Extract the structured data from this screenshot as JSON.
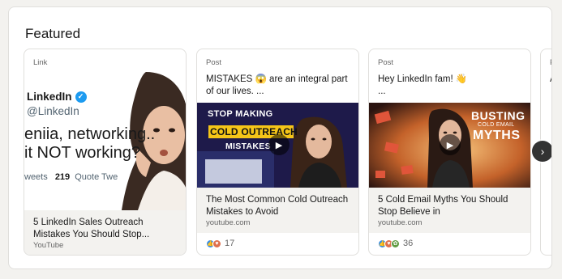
{
  "section": {
    "title": "Featured"
  },
  "cards": [
    {
      "kind": "Link",
      "image": {
        "brand": "LinkedIn",
        "handle": "@LinkedIn",
        "line1": "eniia, networking..",
        "line2": "it NOT working?",
        "stats_prefix": "weets",
        "stats_count": "219",
        "stats_suffix": "Quote Twe"
      },
      "title": "5 LinkedIn Sales Outreach Mistakes You Should Stop...",
      "source": "YouTube"
    },
    {
      "kind": "Post",
      "text_before": "MISTAKES",
      "text_after": "are an integral part of our lives. ...",
      "text_emoji": "screaming-face-icon",
      "image": {
        "line1": "STOP MAKING",
        "line2": "COLD OUTREACH",
        "line3": "MISTAKES"
      },
      "title": "The Most Common Cold Outreach Mistakes to Avoid",
      "source": "youtube.com",
      "reaction_count": "17",
      "reactions": [
        "like-icon",
        "love-icon"
      ]
    },
    {
      "kind": "Post",
      "text_before": "Hey LinkedIn fam!",
      "text_after": "...",
      "text_emoji": "waving-hand-icon",
      "image": {
        "line1": "BUSTING",
        "line2": "COLD EMAIL",
        "line3": "MYTHS"
      },
      "title": "5 Cold Email Myths You Should Stop Believe in",
      "source": "youtube.com",
      "reaction_count": "36",
      "reactions": [
        "like-icon",
        "love-icon",
        "support-icon"
      ]
    },
    {
      "kind": "P",
      "text_before": "A",
      "text_after": ""
    }
  ],
  "colors": {
    "linkedin_blue": "#0a66c2",
    "accent_yellow": "#f5c518"
  }
}
